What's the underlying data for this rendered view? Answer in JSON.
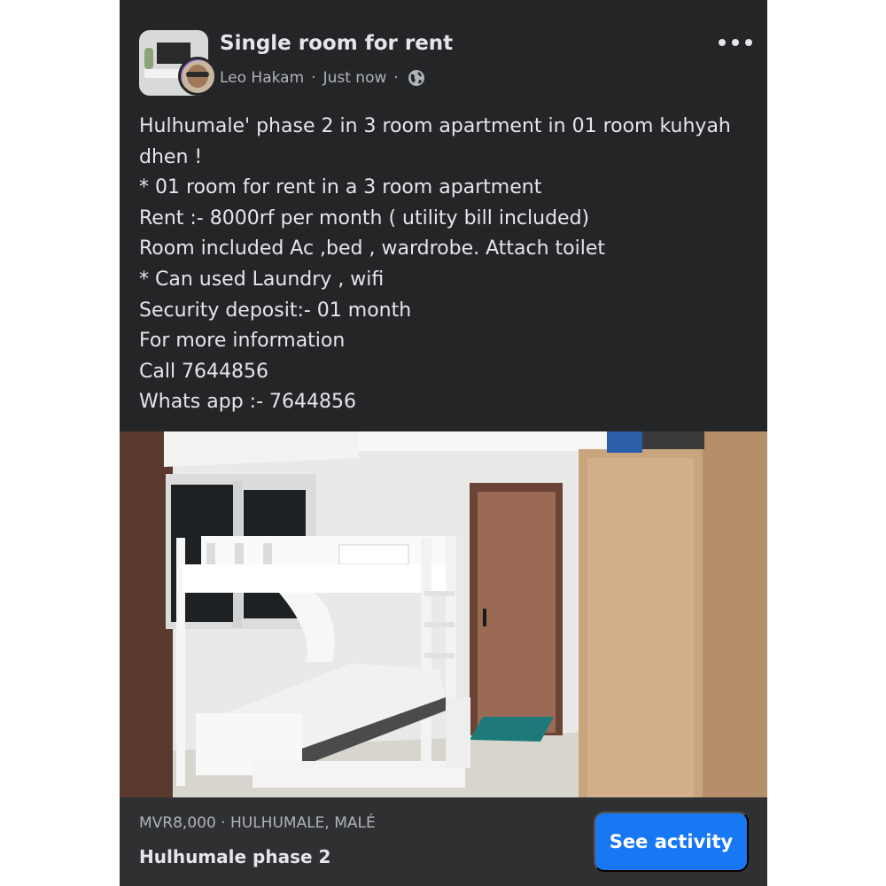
{
  "post": {
    "title": "Single room for rent",
    "author": "Leo Hakam",
    "separator": "·",
    "time": "Just now",
    "privacy_icon": "globe-icon",
    "more_icon": "more-options-icon",
    "body_lines": [
      "Hulhumale' phase 2 in 3 room apartment in 01 room kuhyah",
      "dhen !",
      "* 01 room for rent in a 3 room apartment",
      "Rent :- 8000rf per month ( utility bill included)",
      "Room included Ac ,bed , wardrobe. Attach toilet",
      "* Can used Laundry , wifi",
      "Security deposit:- 01 month",
      "For more information",
      "Call 7644856",
      "Whats app :- 7644856"
    ]
  },
  "listing": {
    "price_location": "MVR8,000 · HULHUMALE, MALÉ",
    "name": "Hulhumale phase 2",
    "action_label": "See activity"
  },
  "colors": {
    "card_bg": "#242526",
    "footer_bg": "#2f3031",
    "primary_text": "#e4e6eb",
    "secondary_text": "#b0b3b8",
    "button": "#1877f2"
  }
}
